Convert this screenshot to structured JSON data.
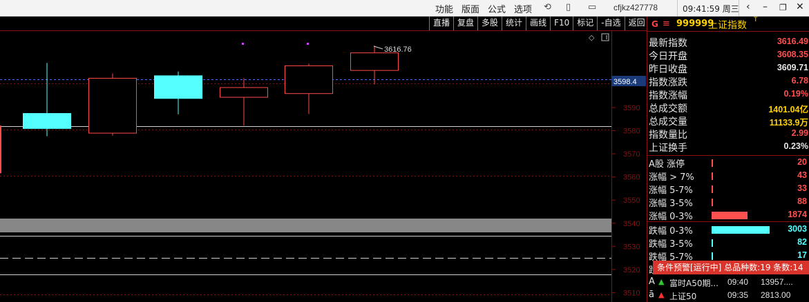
{
  "topbar": {
    "menus": [
      "功能",
      "版面",
      "公式",
      "选项"
    ],
    "account": "cfjkz427778",
    "clock": "09:41:59 周三",
    "icons": [
      "refresh-icon",
      "phone-icon",
      "message-icon",
      "back-arrow-icon",
      "minimize-icon",
      "restore-icon",
      "close-icon"
    ]
  },
  "toolbar": {
    "buttons": [
      "直播",
      "复盘",
      "多股",
      "统计",
      "画线",
      "F10",
      "标记",
      "-自选",
      "返回"
    ]
  },
  "chart_data": {
    "type": "candlestick",
    "y_ticks": [
      "3590",
      "3580",
      "3570",
      "3560",
      "3550",
      "3540",
      "3530",
      "3520",
      "3510"
    ],
    "price_marker": "3598.4",
    "high_label": "3616.76",
    "candles": [
      {
        "open": 3582.2,
        "close": 3561.9,
        "high": 3582.2,
        "low": 3561.9,
        "color": "up"
      },
      {
        "open": 3581.1,
        "close": 3587.6,
        "high": 3609.3,
        "low": 3577.6,
        "color": "down"
      },
      {
        "open": 3579.1,
        "close": 3602.8,
        "high": 3604.7,
        "low": 3577.9,
        "color": "up"
      },
      {
        "open": 3594.1,
        "close": 3603.9,
        "high": 3605.6,
        "low": 3587.1,
        "color": "down"
      },
      {
        "open": 3594.6,
        "close": 3598.8,
        "high": 3602.7,
        "low": 3582.2,
        "color": "up"
      },
      {
        "open": 3596.2,
        "close": 3608.2,
        "high": 3609.0,
        "low": 3587.2,
        "color": "up"
      },
      {
        "open": 3606.2,
        "close": 3613.8,
        "high": 3616.8,
        "low": 3600.0,
        "color": "up"
      }
    ]
  },
  "panel": {
    "g": "G",
    "eq": "≡",
    "code": "999999",
    "name": "上证指数",
    "sup": "T",
    "quotes": [
      {
        "label": "最新指数",
        "value": "3616.49",
        "color": "#ff5050"
      },
      {
        "label": "今日开盘",
        "value": "3608.35",
        "color": "#ff5050"
      },
      {
        "label": "昨日收盘",
        "value": "3609.71",
        "color": "#e6e6e6"
      },
      {
        "label": "指数涨跌",
        "value": "6.78",
        "color": "#ff5050"
      },
      {
        "label": "指数涨幅",
        "value": "0.19%",
        "color": "#ff5050"
      },
      {
        "label": "总成交额",
        "value": "1401.04亿",
        "color": "#ffd200"
      },
      {
        "label": "总成交量",
        "value": "11133.9万",
        "color": "#ffd200"
      },
      {
        "label": "指数量比",
        "value": "2.99",
        "color": "#ff5050"
      },
      {
        "label": "上证换手",
        "value": "0.23%",
        "color": "#e6e6e6"
      }
    ],
    "breadth": [
      {
        "label": "A股 涨停",
        "value": "20",
        "level": 0.011,
        "color": "#ff5050"
      },
      {
        "label": "涨幅 > 7%",
        "value": "43",
        "level": 0.023,
        "color": "#ff5050"
      },
      {
        "label": "涨幅 5-7%",
        "value": "33",
        "level": 0.018,
        "color": "#ff5050"
      },
      {
        "label": "涨幅 3-5%",
        "value": "88",
        "level": 0.029,
        "color": "#ff5050"
      },
      {
        "label": "涨幅 0-3%",
        "value": "1874",
        "level": 0.62,
        "color": "#ff5050"
      },
      {
        "label": "跌幅 0-3%",
        "value": "3003",
        "level": 1.0,
        "color": "#54ffff"
      },
      {
        "label": "跌幅 3-5%",
        "value": "82",
        "level": 0.029,
        "color": "#54ffff"
      },
      {
        "label": "跌幅 5-7%",
        "value": "17",
        "level": 0.011,
        "color": "#54ffff"
      },
      {
        "label": "跌",
        "value": "",
        "level": 0,
        "color": "#54ffff"
      }
    ],
    "cut_labels": [
      "A",
      "ā"
    ]
  },
  "alerts": {
    "header": "条件预警[运行中] 总品种数:19 条数:14",
    "rows": [
      {
        "name": "富时A50期...",
        "time": "09:40",
        "price": "13957....",
        "bell_color": "#2ec72e"
      },
      {
        "name": "上证50",
        "time": "09:35",
        "price": "2813.00",
        "bell_color": "#ff3030"
      }
    ]
  }
}
